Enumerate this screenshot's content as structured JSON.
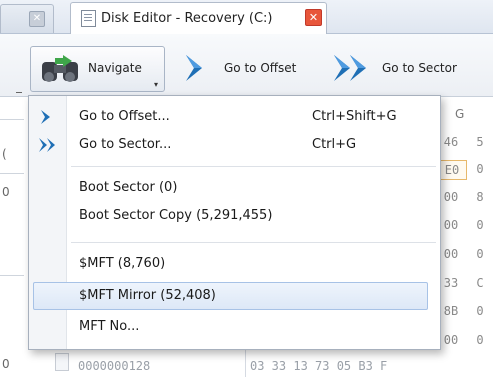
{
  "tabs": {
    "active_title": "Disk Editor - Recovery (C:)",
    "close_glyph": "✕",
    "prev_close_glyph": "✕"
  },
  "toolbar": {
    "navigate_label": "Navigate",
    "navigate_icon": "binoculars-icon",
    "goto_offset_label": "Go to Offset",
    "goto_offset_icon": "chevron-right-icon",
    "goto_sector_label": "Go to Sector",
    "goto_sector_icon": "double-chevron-right-icon",
    "dropdown_glyph": "▾"
  },
  "menu": {
    "items": [
      {
        "label": "Go to Offset...",
        "shortcut": "Ctrl+Shift+G",
        "icon": "chevron-right-icon"
      },
      {
        "label": "Go to Sector...",
        "shortcut": "Ctrl+G",
        "icon": "double-chevron-right-icon"
      },
      {
        "label": "Boot Sector (0)",
        "shortcut": ""
      },
      {
        "label": "Boot Sector Copy (5,291,455)",
        "shortcut": ""
      },
      {
        "label": "$MFT (8,760)",
        "shortcut": ""
      },
      {
        "label": "$MFT Mirror (52,408)",
        "shortcut": "",
        "selected": true
      },
      {
        "label": "MFT No...",
        "shortcut": ""
      }
    ]
  },
  "editor": {
    "col_header": "G",
    "left_values": [
      "(",
      "0",
      "0"
    ],
    "hex_rows": [
      [
        "46",
        "5"
      ],
      [
        "E0",
        "0"
      ],
      [
        "00",
        "8"
      ],
      [
        "00",
        "0"
      ],
      [
        "00",
        "0"
      ],
      [
        "33",
        "C"
      ],
      [
        "8B",
        "0"
      ],
      [
        "00",
        "0"
      ]
    ],
    "status_offset": "0000000128",
    "status_bytes": "03 33 13 73 05 B3 F"
  },
  "colors": {
    "accent": "#1f6fb5",
    "close": "#e8563b",
    "selection": "#dde8f7",
    "highlight": "#e7b86a"
  }
}
